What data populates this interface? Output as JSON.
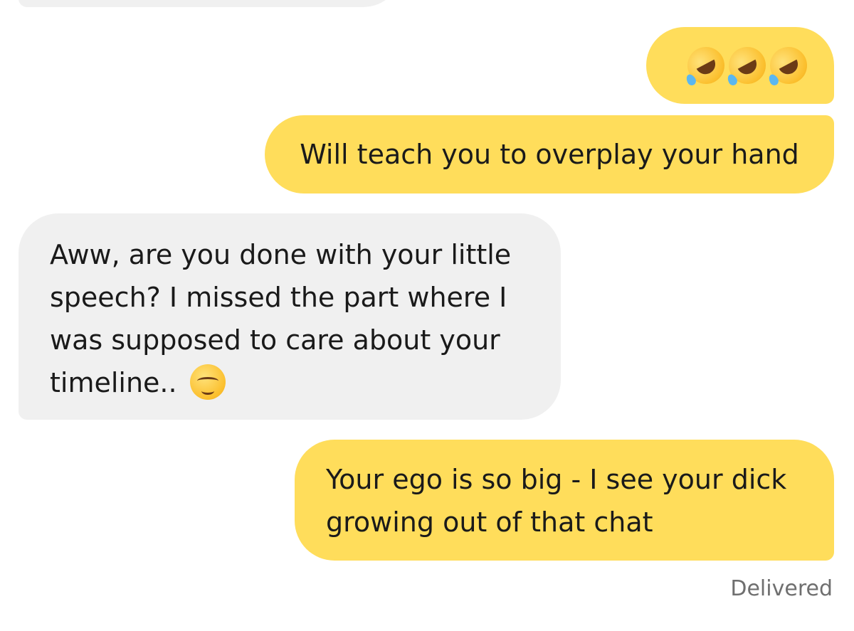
{
  "messages": [
    {
      "id": "partial",
      "direction": "received",
      "text": ""
    },
    {
      "id": "emoji",
      "direction": "sent",
      "emojis": [
        "rofl-emoji",
        "rofl-emoji",
        "rofl-emoji"
      ]
    },
    {
      "id": "teach",
      "direction": "sent",
      "text": "Will teach you to overplay your hand"
    },
    {
      "id": "aww",
      "direction": "received",
      "lines": [
        "Aww, are you done with your little",
        "speech? I missed the part where I",
        "was supposed to care about your",
        "timeline.."
      ],
      "trailing_emoji": "relieved-face-emoji"
    },
    {
      "id": "ego",
      "direction": "sent",
      "lines": [
        "Your ego is so big - I see your dick",
        "growing out of that chat"
      ]
    }
  ],
  "status": {
    "delivered": "Delivered"
  },
  "colors": {
    "sent_bubble": "#ffdd5b",
    "received_bubble": "#f0f0f0",
    "status_text": "#6f6f6f"
  }
}
